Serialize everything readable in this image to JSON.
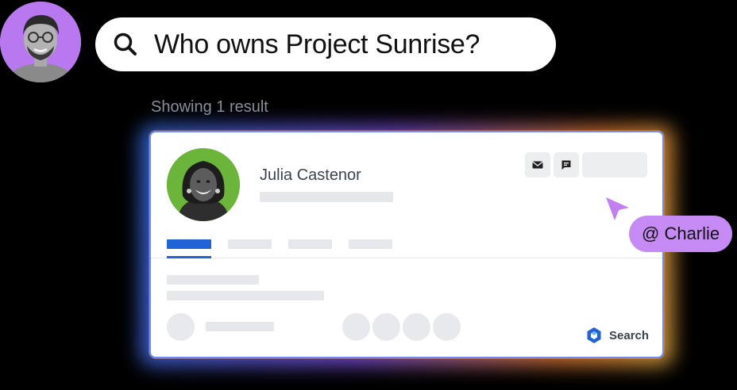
{
  "search": {
    "query": "Who owns Project Sunrise?",
    "icon": "search-icon"
  },
  "results": {
    "count_text": "Showing 1 result"
  },
  "profile_card": {
    "name": "Julia Castenor",
    "actions": [
      {
        "icon": "mail-icon"
      },
      {
        "icon": "chat-icon"
      }
    ],
    "tabs": [
      {
        "active": true
      },
      {
        "active": false
      },
      {
        "active": false
      },
      {
        "active": false
      }
    ],
    "brand_label": "Search",
    "brand_icon": "search-brand-icon"
  },
  "mention": {
    "label": "@ Charlie"
  },
  "colors": {
    "user_avatar_bg": "#b879f0",
    "profile_photo_bg": "#6bb53a",
    "accent_blue": "#1f63d6",
    "mention_bg": "#c58af3",
    "cursor": "#c27ef2"
  }
}
